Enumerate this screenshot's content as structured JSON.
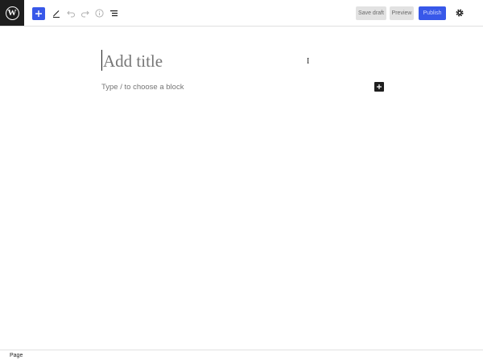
{
  "toolbar": {
    "logo_letter": "W",
    "save_draft_label": "Save draft",
    "preview_label": "Preview",
    "publish_label": "Publish",
    "accent_color": "#3858e9"
  },
  "editor": {
    "title_placeholder": "Add title",
    "block_placeholder": "Type / to choose a block"
  },
  "footer": {
    "breadcrumb": "Page"
  },
  "icons": [
    "wordpress-logo-icon",
    "plus-icon",
    "pencil-icon",
    "undo-icon",
    "redo-icon",
    "info-icon",
    "list-view-icon",
    "gear-icon",
    "text-cursor-icon"
  ]
}
